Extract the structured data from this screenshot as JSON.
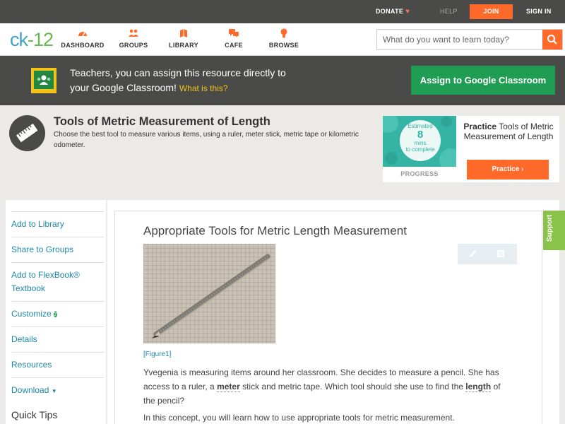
{
  "topbar": {
    "donate": "DONATE",
    "help": "HELP",
    "join": "JOIN",
    "signin": "SIGN IN"
  },
  "nav": {
    "logo_left": "ck",
    "logo_right": "-12",
    "items": [
      {
        "label": "DASHBOARD",
        "icon": "gauge-icon"
      },
      {
        "label": "GROUPS",
        "icon": "people-icon"
      },
      {
        "label": "LIBRARY",
        "icon": "library-icon"
      },
      {
        "label": "CAFE",
        "icon": "chat-icon"
      },
      {
        "label": "BROWSE",
        "icon": "lightbulb-icon"
      }
    ],
    "search_placeholder": "What do you want to learn today?"
  },
  "classroom": {
    "line1": "Teachers, you can assign this resource directly to",
    "line2": "your Google Classroom!",
    "what": "What is this?",
    "button": "Assign to Google Classroom"
  },
  "concept": {
    "title": "Tools of Metric Measurement of Length",
    "description": "Choose the best tool to measure various items, using a ruler, meter stick, metric tape or kilometric odometer.",
    "estimated_top": "Estimated",
    "estimated_num": "8",
    "estimated_unit": "mins",
    "estimated_bottom": "to complete",
    "progress": "PROGRESS",
    "practice_bold": "Practice",
    "practice_title": "Tools of Metric Measurement of Length",
    "practice_button": "Practice"
  },
  "sidebar": {
    "items": [
      {
        "label": "Add to Library"
      },
      {
        "label": "Share to Groups"
      },
      {
        "label": "Add to FlexBook®"
      },
      {
        "label": "Customize"
      },
      {
        "label": "Details"
      },
      {
        "label": "Resources"
      },
      {
        "label": "Download"
      }
    ],
    "flexbook_line2": "Textbook",
    "quick_tips": "Quick Tips"
  },
  "content": {
    "heading": "Appropriate Tools for Metric Length Measurement",
    "figure_caption": "[Figure1]",
    "p1_a": "Yvegenia is measuring items around her classroom. She decides to measure a pencil. She has access to a ruler, a ",
    "p1_term1": "meter",
    "p1_b": " stick and metric tape. Which tool should she use to find the ",
    "p1_term2": "length",
    "p1_c": " of the pencil?",
    "p2": "In this concept, you will learn how to use appropriate tools for metric measurement."
  },
  "support": "Support",
  "colors": {
    "accent_orange": "#ff6a2b",
    "google_green": "#1f9e53",
    "link_blue": "#1e88a8",
    "dark_bar": "#4a4a48",
    "support_green": "#8bc34a"
  }
}
